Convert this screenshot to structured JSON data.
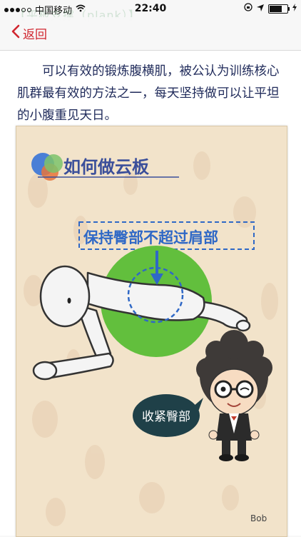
{
  "status_bar": {
    "carrier": "中国移动",
    "time": "22:40"
  },
  "ghost_title": "【平板支撑（plank）】",
  "nav": {
    "back_label": "返回"
  },
  "article": {
    "intro": "可以有效的锻炼腹横肌，被公认为训练核心肌群最有效的方法之一，每天坚持做可以让平坦的小腹重见天日。"
  },
  "illustration": {
    "title": "如何做云板",
    "tip_label": "保持臀部不超过肩部",
    "speech_text": "收紧臀部",
    "signature": "Bob"
  }
}
